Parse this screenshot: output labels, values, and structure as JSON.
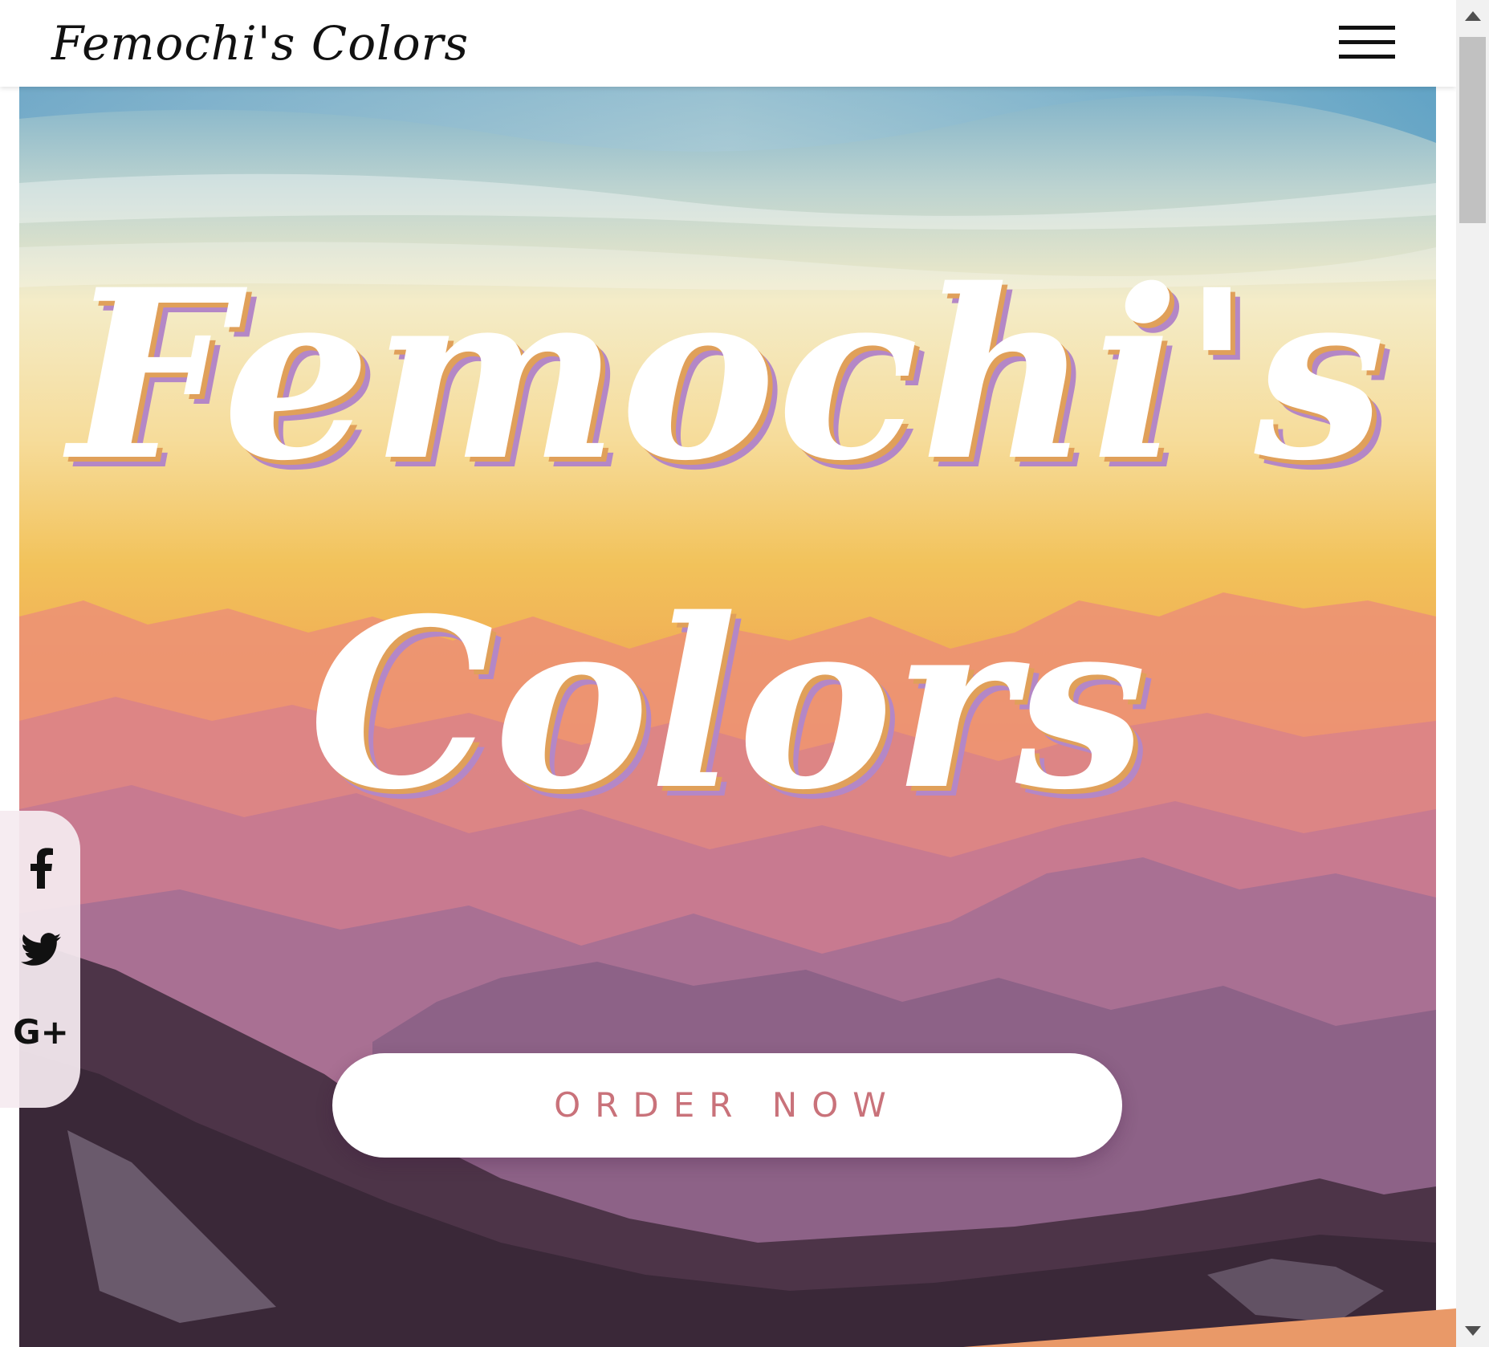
{
  "navbar": {
    "brand": "Femochi's Colors",
    "menu_icon": "hamburger-menu-icon"
  },
  "hero": {
    "title_line1": "Femochi's",
    "title_line2": "Colors",
    "order_button": "ORDER NOW"
  },
  "social": {
    "items": [
      {
        "icon": "facebook-icon"
      },
      {
        "icon": "twitter-icon"
      },
      {
        "icon": "google-plus-icon",
        "glyph": "G+"
      }
    ]
  },
  "colors": {
    "accent": "#e99968",
    "button_text": "#c9727a",
    "shadow_orange": "#e0a05a",
    "shadow_purple": "#b487c6"
  }
}
